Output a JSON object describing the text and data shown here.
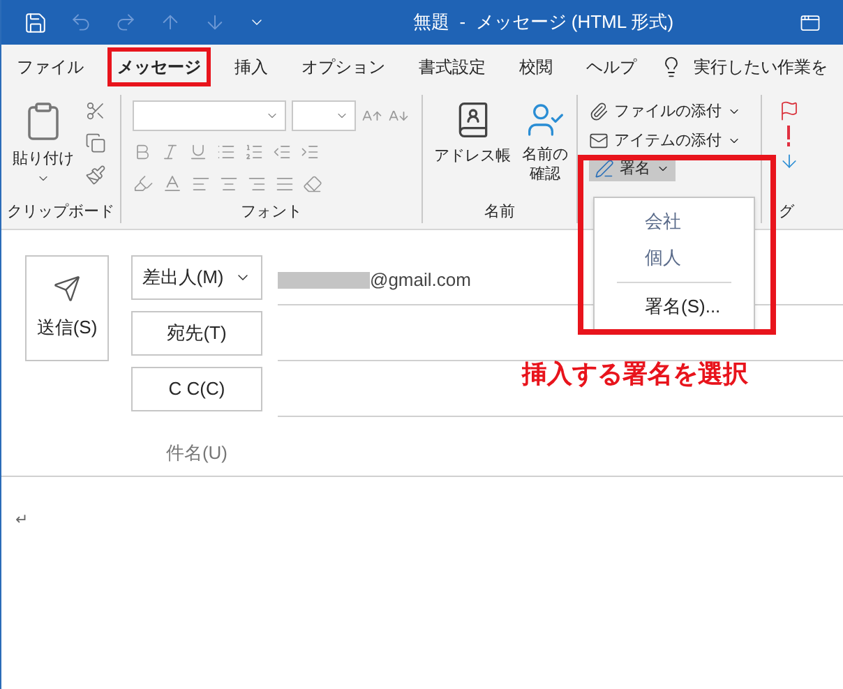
{
  "window": {
    "title": "無題  -  メッセージ (HTML 形式)"
  },
  "tabs": [
    {
      "label": "ファイル",
      "selected": false,
      "highlighted": false
    },
    {
      "label": "メッセージ",
      "selected": true,
      "highlighted": true
    },
    {
      "label": "挿入",
      "selected": false,
      "highlighted": false
    },
    {
      "label": "オプション",
      "selected": false,
      "highlighted": false
    },
    {
      "label": "書式設定",
      "selected": false,
      "highlighted": false
    },
    {
      "label": "校閲",
      "selected": false,
      "highlighted": false
    },
    {
      "label": "ヘルプ",
      "selected": false,
      "highlighted": false
    }
  ],
  "tell_me": "実行したい作業を",
  "ribbon": {
    "clipboard": {
      "paste": "貼り付け",
      "label": "クリップボード"
    },
    "font": {
      "label": "フォント"
    },
    "names": {
      "address_book": "アドレス帳",
      "check_names": [
        "名前の",
        "確認"
      ],
      "label": "名前"
    },
    "include": {
      "attach_file": "ファイルの添付",
      "attach_item": "アイテムの添付",
      "signature": "署名",
      "expanded": true
    },
    "tags": {
      "label": "グ"
    }
  },
  "signature_menu": {
    "highlighted": true,
    "items": [
      {
        "kind": "signature",
        "label": "会社"
      },
      {
        "kind": "signature",
        "label": "個人"
      },
      {
        "kind": "command",
        "label": "署名(S)..."
      }
    ]
  },
  "compose": {
    "send": "送信(S)",
    "from_button": "差出人(M)",
    "from_value": "@gmail.com",
    "from_redacted": true,
    "to_button": "宛先(T)",
    "cc_button": "C C(C)",
    "subject_label": "件名(U)",
    "body": "↵"
  },
  "annotation": "挿入する署名を選択"
}
